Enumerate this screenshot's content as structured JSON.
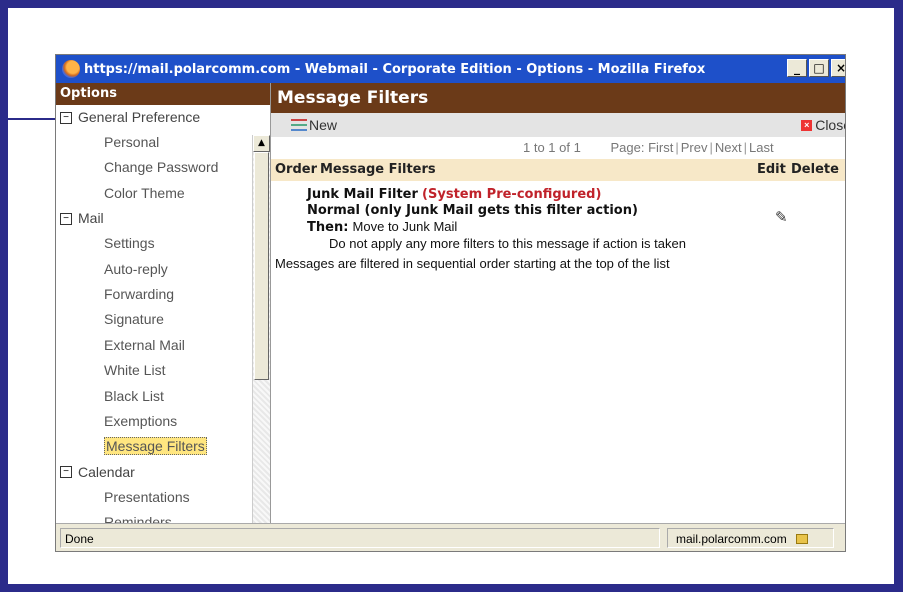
{
  "window": {
    "title": "https://mail.polarcomm.com - Webmail - Corporate Edition - Options - Mozilla Firefox",
    "controls": {
      "minimize": "_",
      "maximize": "□",
      "close": "×"
    }
  },
  "sidebar": {
    "header": "Options",
    "groups": [
      {
        "label": "General Preference",
        "expander": "−",
        "items": [
          "Personal",
          "Change Password",
          "Color Theme"
        ]
      },
      {
        "label": "Mail",
        "expander": "−",
        "items": [
          "Settings",
          "Auto-reply",
          "Forwarding",
          "Signature",
          "External Mail",
          "White List",
          "Black List",
          "Exemptions",
          "Message Filters"
        ]
      },
      {
        "label": "Calendar",
        "expander": "−",
        "items": [
          "Presentations",
          "Reminders"
        ]
      }
    ],
    "selected_item": "Message Filters"
  },
  "main": {
    "title": "Message Filters",
    "toolbar": {
      "new_label": "New",
      "close_label": "Close"
    },
    "pager": {
      "count": "1 to 1 of 1",
      "page_label": "Page:",
      "first": "First",
      "prev": "Prev",
      "next": "Next",
      "last": "Last"
    },
    "columns": {
      "order": "Order",
      "filters": "Message Filters",
      "edit": "Edit",
      "delete": "Delete"
    },
    "filter": {
      "name": "Junk Mail Filter",
      "system_tag": "(System Pre-configured)",
      "condition": "Normal (only Junk Mail gets this filter action)",
      "then_label": "Then:",
      "then_value": "Move to Junk Mail",
      "stop_rule": "Do not apply any more filters to this message if action is taken"
    },
    "note": "Messages are filtered in sequential order starting at the top of the list"
  },
  "statusbar": {
    "status": "Done",
    "domain": "mail.polarcomm.com"
  },
  "colors": {
    "header_brown": "#6b3a18",
    "column_header": "#f7e8c8",
    "system_red": "#c0222a",
    "titlebar_blue": "#1e50c9",
    "frame_navy": "#2b2b8a"
  }
}
